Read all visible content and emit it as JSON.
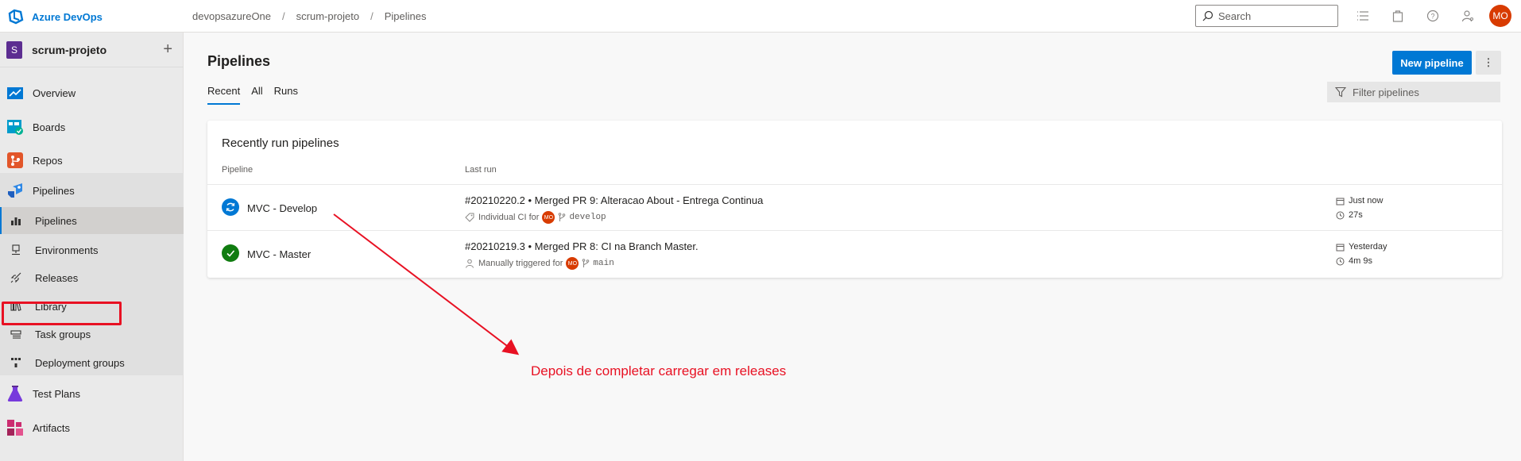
{
  "brand": {
    "name": "Azure DevOps"
  },
  "breadcrumb": [
    "devopsazureOne",
    "scrum-projeto",
    "Pipelines"
  ],
  "search": {
    "placeholder": "Search"
  },
  "user": {
    "initials": "MO"
  },
  "project": {
    "badge": "S",
    "name": "scrum-projeto"
  },
  "sidebar": {
    "items": [
      {
        "label": "Overview",
        "icon": "overview-icon"
      },
      {
        "label": "Boards",
        "icon": "boards-icon"
      },
      {
        "label": "Repos",
        "icon": "repos-icon"
      },
      {
        "label": "Pipelines",
        "icon": "pipelines-icon"
      },
      {
        "label": "Pipelines",
        "icon": "pipelines-sub-icon"
      },
      {
        "label": "Environments",
        "icon": "environments-icon"
      },
      {
        "label": "Releases",
        "icon": "releases-icon"
      },
      {
        "label": "Library",
        "icon": "library-icon"
      },
      {
        "label": "Task groups",
        "icon": "task-groups-icon"
      },
      {
        "label": "Deployment groups",
        "icon": "deployment-groups-icon"
      },
      {
        "label": "Test Plans",
        "icon": "test-plans-icon"
      },
      {
        "label": "Artifacts",
        "icon": "artifacts-icon"
      }
    ]
  },
  "main": {
    "title": "Pipelines",
    "new_button": "New pipeline",
    "more_button": "⋮",
    "tabs": [
      "Recent",
      "All",
      "Runs"
    ],
    "filter_placeholder": "Filter pipelines",
    "card": {
      "title": "Recently run pipelines",
      "col_pipeline": "Pipeline",
      "col_last_run": "Last run",
      "rows": [
        {
          "name": "MVC - Develop",
          "status": "running",
          "run_title": "#20210220.2 • Merged PR 9: Alteracao About - Entrega Continua",
          "trigger": "Individual CI for",
          "avatar": "MO",
          "branch": "develop",
          "when": "Just now",
          "duration": "27s"
        },
        {
          "name": "MVC - Master",
          "status": "succeeded",
          "run_title": "#20210219.3 • Merged PR 8: CI na Branch Master.",
          "trigger": "Manually triggered for",
          "avatar": "MO",
          "branch": "main",
          "when": "Yesterday",
          "duration": "4m 9s"
        }
      ]
    }
  },
  "annotation": {
    "text": "Depois de completar carregar em releases",
    "color": "#e81123"
  },
  "colors": {
    "accent": "#0078d4",
    "annotation": "#e81123",
    "success": "#107c10"
  }
}
